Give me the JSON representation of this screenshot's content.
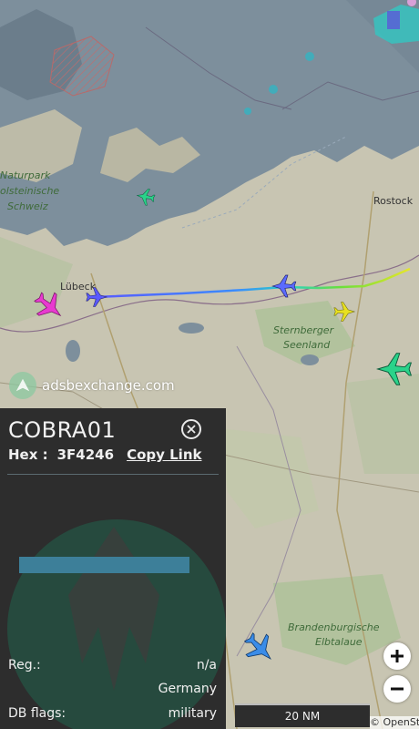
{
  "map": {
    "places": [
      {
        "text": "Naturpark",
        "id": "naturpark"
      },
      {
        "text": "olsteinische",
        "id": "holsteinische"
      },
      {
        "text": "Schweiz",
        "id": "schweiz"
      },
      {
        "text": "Sternberger",
        "id": "sternberger"
      },
      {
        "text": "Seenland",
        "id": "seenland"
      },
      {
        "text": "Brandenburgische",
        "id": "brandenburgische"
      },
      {
        "text": "Elbtalaue",
        "id": "elbtalaue"
      }
    ],
    "cities": {
      "rostock": "Rostock",
      "lubeck": "Lübeck"
    },
    "watermark": "adsbexchange.com"
  },
  "aircraft_colors": {
    "selected": "#e83ad0",
    "track_start": "#5a5aff",
    "track_end": "#e6e62a",
    "yellow": "#e8e020",
    "green": "#2ad38a",
    "blue": "#3a8ce8"
  },
  "panel": {
    "callsign": "COBRA01",
    "hex_label": "Hex :",
    "hex_value": "3F4246",
    "copy_link": "Copy Link",
    "reg_label": "Reg.:",
    "reg_value": "n/a",
    "country": "Germany",
    "dbflags_label": "DB flags:",
    "dbflags_value": "military"
  },
  "controls": {
    "zoom_in": "+",
    "zoom_out": "−",
    "scale": "20 NM",
    "attribution": "© OpenStreetMap contributors"
  }
}
